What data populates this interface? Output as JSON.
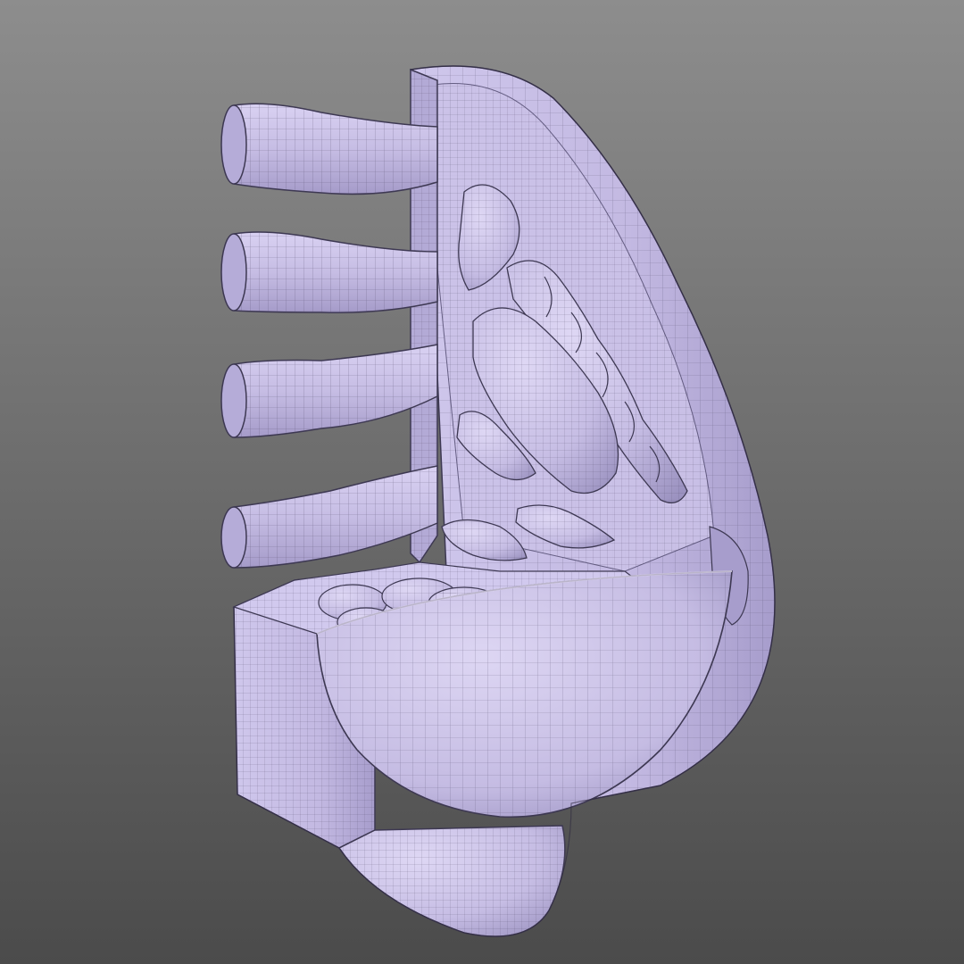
{
  "viewport": {
    "background_top_color": "#8d8d8d",
    "background_bottom_color": "#4b4b4b"
  },
  "model": {
    "mesh_fill_color": "#c9c0e6",
    "mesh_shadow_color": "#8b81b0",
    "wireframe_color": "#4e4866",
    "parts": [
      "rib-bar",
      "rib-bar",
      "rib-bar",
      "rib-bar",
      "back-wall-slab",
      "curved-shell",
      "cup-bowl",
      "base-block",
      "lobe-large",
      "lobe-chain",
      "lobe-small",
      "lobe-pebble",
      "cluster-base"
    ]
  }
}
